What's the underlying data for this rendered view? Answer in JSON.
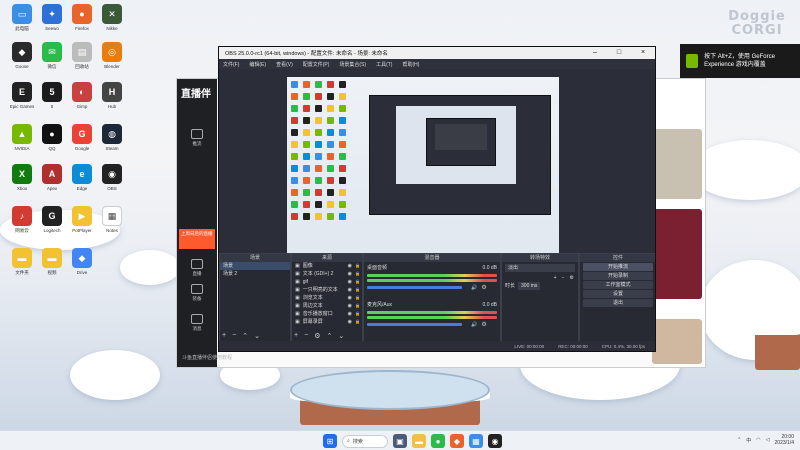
{
  "brand": {
    "line1": "Doggie",
    "line2": "CORGI"
  },
  "toast": {
    "text": "按下 Alt+Z，使用 GeForce Experience 游戏内覆盖"
  },
  "desktop_icons": [
    {
      "label": "此电脑",
      "color": "#3a8ee6",
      "glyph": "▭"
    },
    {
      "label": "Seewo",
      "color": "#2f6fd8",
      "glyph": "✦"
    },
    {
      "label": "Firefox",
      "color": "#e8642a",
      "glyph": "●"
    },
    {
      "label": "Nikke",
      "color": "#3a5a3a",
      "glyph": "✕"
    },
    {
      "label": "Goose",
      "color": "#2a2a2a",
      "glyph": "◆"
    },
    {
      "label": "微信",
      "color": "#2bbb4a",
      "glyph": "✉"
    },
    {
      "label": "回收站",
      "color": "#bbbbbb",
      "glyph": "▤"
    },
    {
      "label": "Blender",
      "color": "#e87d0d",
      "glyph": "◎"
    },
    {
      "label": "Epic Games",
      "color": "#222222",
      "glyph": "E"
    },
    {
      "label": "5",
      "color": "#1c1c1c",
      "glyph": "5"
    },
    {
      "label": "Gimp",
      "color": "#c94040",
      "glyph": "◐"
    },
    {
      "label": "Hub",
      "color": "#444444",
      "glyph": "H"
    },
    {
      "label": "NVIDIA",
      "color": "#76b900",
      "glyph": "▲"
    },
    {
      "label": "QQ",
      "color": "#111111",
      "glyph": "●"
    },
    {
      "label": "Google",
      "color": "#ea4335",
      "glyph": "G"
    },
    {
      "label": "Steam",
      "color": "#1b2838",
      "glyph": "◍"
    },
    {
      "label": "Xbox",
      "color": "#107c10",
      "glyph": "X"
    },
    {
      "label": "Apex",
      "color": "#b03030",
      "glyph": "A"
    },
    {
      "label": "Edge",
      "color": "#0c8bd6",
      "glyph": "e"
    },
    {
      "label": "OBS",
      "color": "#222222",
      "glyph": "◉"
    },
    {
      "label": "网易云",
      "color": "#d33a31",
      "glyph": "♪"
    },
    {
      "label": "Logitech",
      "color": "#222222",
      "glyph": "G"
    },
    {
      "label": "PotPlayer",
      "color": "#f2c230",
      "glyph": "▶"
    },
    {
      "label": "Notes",
      "color": "#ffffff",
      "glyph": "▦"
    },
    {
      "label": "文件夹",
      "color": "#f2c230",
      "glyph": "▬"
    },
    {
      "label": "视频",
      "color": "#f2c230",
      "glyph": "▬"
    },
    {
      "label": "Drive",
      "color": "#4285f4",
      "glyph": "◆"
    }
  ],
  "obs": {
    "title": "OBS 25.0.0-rc1 (64-bit, windows) - 配置文件: 未命名 - 场景: 未命名",
    "menu": [
      "文件(F)",
      "编辑(E)",
      "查看(V)",
      "配置文件(P)",
      "场景集合(S)",
      "工具(T)",
      "帮助(H)"
    ],
    "docks": {
      "scenes": {
        "header": "场景",
        "items": [
          "场景",
          "场景 2"
        ]
      },
      "sources": {
        "header": "来源",
        "items": [
          "图像",
          "文本 (GDI+) 2",
          "gif",
          "一只明亮的文本",
          "浏览文本",
          "周边文本",
          "音乐播放窗口",
          "屏幕录屏"
        ]
      },
      "mixer": {
        "header": "混音器",
        "tracks": [
          {
            "name": "桌面音频",
            "level": "0.0 dB"
          },
          {
            "name": "麦克风/Aux",
            "level": "0.0 dB"
          }
        ]
      },
      "transitions": {
        "header": "转场特效",
        "type": "淡出",
        "duration_label": "时长",
        "duration": "300 ms"
      },
      "controls": {
        "header": "控件",
        "buttons": [
          "开始推流",
          "开始录制",
          "工作室模式",
          "设置",
          "退出"
        ]
      }
    },
    "status": {
      "live": "LIVE: 00:00:00",
      "rec": "REC: 00:00:00",
      "cpu": "CPU: 0.4%, 30.00 fps"
    }
  },
  "liveapp": {
    "logo": "直播伴",
    "side": [
      "推流",
      "直播",
      "装备",
      "消息"
    ],
    "redbox": "上周日后的直播",
    "tip": "斗鱼直播伴侣使用教程"
  },
  "taskbar": {
    "search_label": "搜索",
    "ime": "中",
    "time": "20:00",
    "date": "2023/1/4"
  }
}
